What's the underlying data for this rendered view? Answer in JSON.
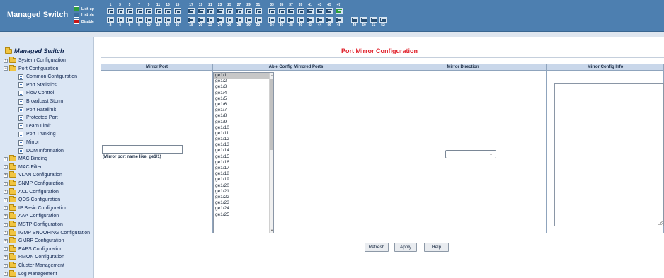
{
  "header": {
    "brand": "Managed Switch",
    "legend": [
      "Link up",
      "Link dn",
      "Disable"
    ],
    "odd_ports": [
      "1",
      "3",
      "5",
      "7",
      "9",
      "11",
      "13",
      "15",
      "17",
      "19",
      "21",
      "23",
      "25",
      "27",
      "29",
      "31",
      "33",
      "35",
      "37",
      "39",
      "41",
      "43",
      "45",
      "47"
    ],
    "even_ports": [
      "2",
      "4",
      "6",
      "8",
      "10",
      "12",
      "14",
      "16",
      "18",
      "20",
      "22",
      "24",
      "26",
      "28",
      "30",
      "32",
      "34",
      "36",
      "38",
      "40",
      "42",
      "44",
      "46",
      "48",
      "49",
      "50",
      "51",
      "52"
    ],
    "linked_up_ports": [
      "47"
    ]
  },
  "sidebar": {
    "title": "Managed Switch",
    "items": [
      {
        "label": "System Configuration",
        "type": "folder",
        "expanded": false
      },
      {
        "label": "Port Configuration",
        "type": "folder",
        "expanded": true
      },
      {
        "label": "Common Configuration",
        "type": "page"
      },
      {
        "label": "Port Statistics",
        "type": "page"
      },
      {
        "label": "Flow Control",
        "type": "page"
      },
      {
        "label": "Broadcast Storm",
        "type": "page"
      },
      {
        "label": "Port Ratelimit",
        "type": "page"
      },
      {
        "label": "Protected Port",
        "type": "page"
      },
      {
        "label": "Learn Limit",
        "type": "page"
      },
      {
        "label": "Port Trunking",
        "type": "page"
      },
      {
        "label": "Mirror",
        "type": "page"
      },
      {
        "label": "DDM Information",
        "type": "page"
      },
      {
        "label": "MAC Binding",
        "type": "folder",
        "expanded": false
      },
      {
        "label": "MAC Filter",
        "type": "folder",
        "expanded": false
      },
      {
        "label": "VLAN Configuration",
        "type": "folder",
        "expanded": false
      },
      {
        "label": "SNMP Configuration",
        "type": "folder",
        "expanded": false
      },
      {
        "label": "ACL Configuration",
        "type": "folder",
        "expanded": false
      },
      {
        "label": "QOS Configuration",
        "type": "folder",
        "expanded": false
      },
      {
        "label": "IP Basic Configuration",
        "type": "folder",
        "expanded": false
      },
      {
        "label": "AAA Configuration",
        "type": "folder",
        "expanded": false
      },
      {
        "label": "MSTP Configuration",
        "type": "folder",
        "expanded": false
      },
      {
        "label": "IGMP SNOOPING Configuration",
        "type": "folder",
        "expanded": false
      },
      {
        "label": "GMRP Configuration",
        "type": "folder",
        "expanded": false
      },
      {
        "label": "EAPS Configuration",
        "type": "folder",
        "expanded": false
      },
      {
        "label": "RMON Configuration",
        "type": "folder",
        "expanded": false
      },
      {
        "label": "Cluster Management",
        "type": "folder",
        "expanded": false
      },
      {
        "label": "Log Management",
        "type": "folder",
        "expanded": false
      }
    ]
  },
  "main": {
    "title": "Port Mirror Configuration",
    "columns": [
      "Mirror Port",
      "Able Config Mirrored Ports",
      "Mirror Direction",
      "Mirror Config Info"
    ],
    "mirror_port_value": "",
    "mirror_port_hint": "(Mirror port name like: ge1/1)",
    "port_options": [
      "ge1/1",
      "ge1/2",
      "ge1/3",
      "ge1/4",
      "ge1/5",
      "ge1/6",
      "ge1/7",
      "ge1/8",
      "ge1/9",
      "ge1/10",
      "ge1/11",
      "ge1/12",
      "ge1/13",
      "ge1/14",
      "ge1/15",
      "ge1/16",
      "ge1/17",
      "ge1/18",
      "ge1/19",
      "ge1/20",
      "ge1/21",
      "ge1/22",
      "ge1/23",
      "ge1/24",
      "ge1/25"
    ],
    "selected_port": "ge1/1",
    "direction_value": "",
    "config_info": "",
    "buttons": {
      "refresh": "Refresh",
      "apply": "Apply",
      "help": "Help"
    }
  }
}
